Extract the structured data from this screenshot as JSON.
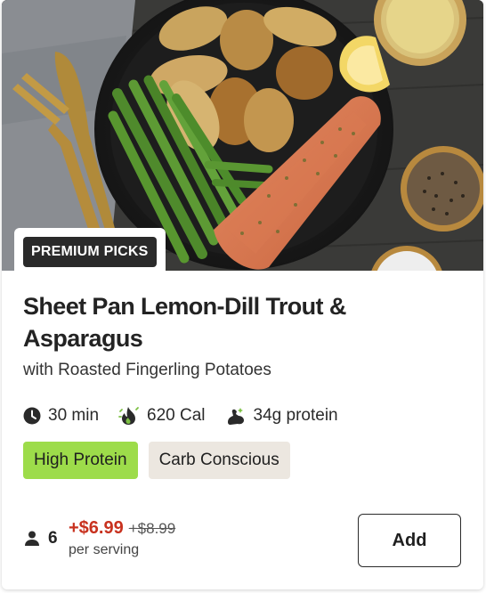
{
  "card": {
    "badge": "PREMIUM PICKS",
    "title": "Sheet Pan Lemon-Dill Trout & Asparagus",
    "subtitle": "with Roasted Fingerling Potatoes",
    "stats": {
      "time": "30 min",
      "calories": "620 Cal",
      "protein": "34g protein"
    },
    "tags": [
      "High Protein",
      "Carb Conscious"
    ],
    "servings": "6",
    "price": "+$6.99",
    "old_price": "+$8.99",
    "per_serving": "per serving",
    "add_label": "Add"
  },
  "icons": {
    "time": "clock-icon",
    "calories": "flame-icon",
    "protein": "muscle-icon",
    "servings": "person-icon"
  },
  "colors": {
    "price": "#c8321f",
    "tag_green": "#9ddc4a",
    "tag_beige": "#ece7e0",
    "badge_bg": "#2a2a2a"
  }
}
